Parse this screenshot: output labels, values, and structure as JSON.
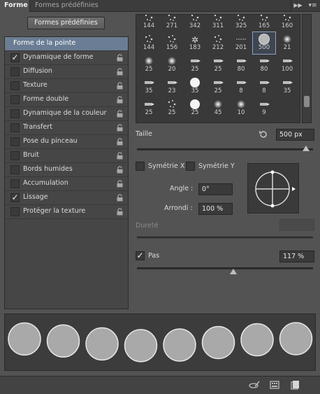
{
  "tabs": [
    {
      "label": "Forme",
      "active": true
    },
    {
      "label": "Formes prédéfinies",
      "active": false
    }
  ],
  "tab_collapse_icon": "double-chevron-right-icon",
  "tab_menu_icon": "panel-menu-icon",
  "preset_button": "Formes prédéfinies",
  "options": [
    {
      "label": "Forme de la pointe",
      "selected": true
    },
    {
      "label": "Dynamique de forme",
      "checked": true,
      "locked": true
    },
    {
      "label": "Diffusion",
      "checked": false,
      "locked": true
    },
    {
      "label": "Texture",
      "checked": false,
      "locked": true
    },
    {
      "label": "Forme double",
      "checked": false,
      "locked": true
    },
    {
      "label": "Dynamique de la couleur",
      "checked": false,
      "locked": true
    },
    {
      "label": "Transfert",
      "checked": false,
      "locked": true
    },
    {
      "label": "Pose du pinceau",
      "checked": false,
      "locked": true
    },
    {
      "label": "Bruit",
      "checked": false,
      "locked": true
    },
    {
      "label": "Bords humides",
      "checked": false,
      "locked": true
    },
    {
      "label": "Accumulation",
      "checked": false,
      "locked": true
    },
    {
      "label": "Lissage",
      "checked": true,
      "locked": true
    },
    {
      "label": "Protéger la texture",
      "checked": false,
      "locked": true
    }
  ],
  "brushes": [
    [
      "144",
      "271",
      "342",
      "311",
      "325",
      "165",
      "160"
    ],
    [
      "144",
      "156",
      "183",
      "212",
      "201",
      "500",
      "21"
    ],
    [
      "25",
      "20",
      "25",
      "25",
      "80",
      "80",
      "100"
    ],
    [
      "35",
      "23",
      "35",
      "25",
      "8",
      "8",
      "35"
    ],
    [
      "25",
      "25",
      "25",
      "45",
      "10",
      "9",
      ""
    ]
  ],
  "brush_selected": "500",
  "size": {
    "label": "Taille",
    "value": "500 px",
    "reset_icon": "reset-icon",
    "fraction": 0.98
  },
  "flip_x": {
    "label": "Symétrie X",
    "checked": false
  },
  "flip_y": {
    "label": "Symétrie Y",
    "checked": false
  },
  "angle": {
    "label": "Angle :",
    "value": "0°"
  },
  "roundness": {
    "label": "Arrondi :",
    "value": "100 %"
  },
  "hardness": {
    "label": "Dureté",
    "value": ""
  },
  "spacing": {
    "label": "Pas",
    "checked": true,
    "value": "117 %",
    "fraction": 0.55
  },
  "bottom_icons": [
    "toggle-brush-projection-icon",
    "brush-grid-icon",
    "new-brush-icon"
  ]
}
